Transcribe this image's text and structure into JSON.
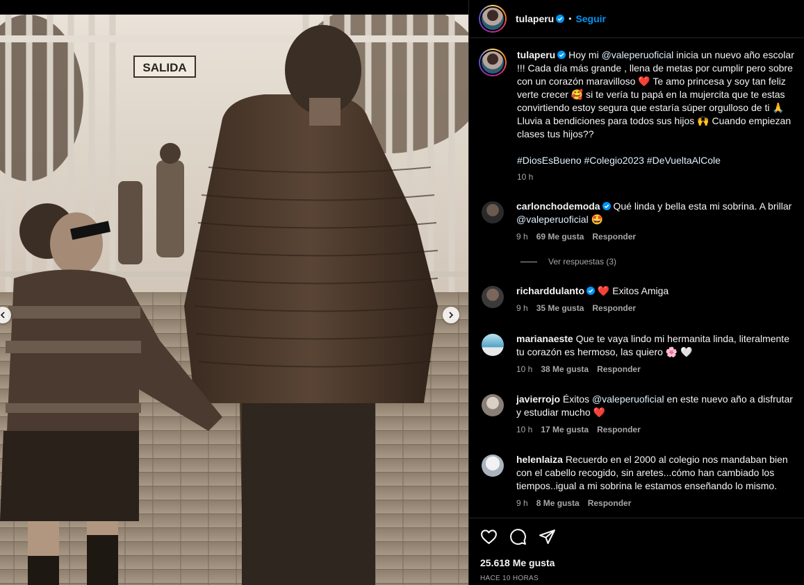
{
  "post": {
    "author": "tulaperu",
    "follow_label": "Seguir",
    "caption_parts": {
      "p1": "Hoy mi ",
      "mention": "@valeperuoficial",
      "p2": " inicia un nuevo año escolar !!! Cada día más grande , llena de metas por cumplir pero sobre con un corazón maravilloso ",
      "e1": "❤️",
      "p3": " Te amo princesa y soy tan feliz verte crecer ",
      "e2": "🥰",
      "p4": " si te vería tu papá en la mujercita que te estas convirtiendo estoy segura que estaría súper orgulloso de ti ",
      "e3": "🙏",
      "p5": " Lluvia a bendiciones para todos sus hijos ",
      "e4": "🙌",
      "p6": " Cuando empiezan clases tus hijos??"
    },
    "hashtags": "#DiosEsBueno #Colegio2023 #DeVueltaAlCole",
    "caption_time": "10 h",
    "likes": "25.618 Me gusta",
    "posted": "HACE 10 HORAS"
  },
  "photo": {
    "sign": "SALIDA"
  },
  "comments": [
    {
      "user": "carlonchodemoda",
      "text": "Qué linda y bella esta mi sobrina. A brillar ",
      "mention": "@valeperuoficial",
      "emoji": "🤩",
      "time": "9 h",
      "likes": "69 Me gusta",
      "reply": "Responder",
      "view_replies": "Ver respuestas (3)"
    },
    {
      "user": "richarddulanto",
      "heart": "❤️",
      "text": " Exitos Amiga",
      "time": "9 h",
      "likes": "35 Me gusta",
      "reply": "Responder"
    },
    {
      "user": "marianaeste",
      "text": " Que te vaya lindo mi hermanita linda, literalmente tu corazón es hermoso, las quiero ",
      "emoji": "🌸 🤍",
      "time": "10 h",
      "likes": "38 Me gusta",
      "reply": "Responder"
    },
    {
      "user": "javierrojo",
      "text1": " Éxitos ",
      "mention": "@valeperuoficial",
      "text2": " en este nuevo año a disfrutar y estudiar mucho ",
      "emoji": "❤️",
      "time": "10 h",
      "likes": "17 Me gusta",
      "reply": "Responder"
    },
    {
      "user": "helenlaiza",
      "text": " Recuerdo en el 2000 al colegio nos mandaban bien con el cabello recogido, sin aretes...cómo han cambiado los tiempos..igual a mi sobrina le estamos enseñando lo mismo.",
      "time": "9 h",
      "likes": "8 Me gusta",
      "reply": "Responder"
    }
  ],
  "icons": {
    "like": "heart-icon",
    "comment": "comment-icon",
    "share": "share-icon",
    "verified": "verified-badge-icon",
    "prev": "chevron-left-icon",
    "next": "chevron-right-icon"
  },
  "colors": {
    "accent": "#0095f6",
    "background": "#000000",
    "muted": "#a8a8a8",
    "heart": "#e0245e"
  }
}
